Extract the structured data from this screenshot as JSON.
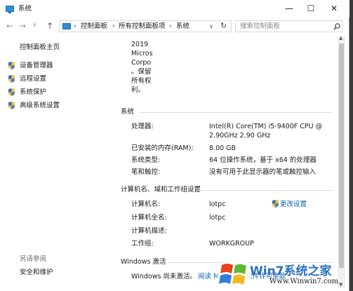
{
  "window": {
    "title": "系统",
    "minimize_glyph": "—",
    "maximize_glyph": "☐",
    "close_glyph": "✕"
  },
  "nav": {
    "back_glyph": "←",
    "forward_glyph": "→",
    "dropdown_glyph": "∨",
    "up_glyph": "↑",
    "breadcrumb": [
      "控制面板",
      "所有控制面板项",
      "系统"
    ],
    "separator": "›",
    "refresh_glyph": "↻",
    "search_placeholder": "搜索控制面板"
  },
  "sidebar": {
    "home": "控制面板主页",
    "items": [
      {
        "label": "设备管理器",
        "icon": "shield-icon"
      },
      {
        "label": "远程设置",
        "icon": "shield-icon"
      },
      {
        "label": "系统保护",
        "icon": "shield-icon"
      },
      {
        "label": "高级系统设置",
        "icon": "shield-icon"
      }
    ],
    "see_also": "另请参阅",
    "see_also_items": [
      "安全和维护"
    ]
  },
  "copyright_lines": [
    "2019",
    "Micros",
    "Corpo",
    "。保留",
    "所有权",
    "利。"
  ],
  "system": {
    "heading": "系统",
    "rows": [
      {
        "label": "处理器:",
        "value": "Intel(R) Core(TM) i5-9400F CPU @",
        "value2": "2.90GHz   2.90 GHz"
      },
      {
        "label": "已安装的内存(RAM):",
        "value": "8.00 GB"
      },
      {
        "label": "系统类型:",
        "value": "64 位操作系统，基于 x64 的处理器"
      },
      {
        "label": "笔和触控:",
        "value": "没有可用于此显示器的笔或触控输入"
      }
    ]
  },
  "computer": {
    "heading": "计算机名、域和工作组设置",
    "change_settings": "更改设置",
    "rows": [
      {
        "label": "计算机名:",
        "value": "lotpc"
      },
      {
        "label": "计算机全名:",
        "value": "lotpc"
      },
      {
        "label": "计算机描述:",
        "value": ""
      },
      {
        "label": "工作组:",
        "value": "WORKGROUP"
      }
    ]
  },
  "activation": {
    "heading": "Windows 激活",
    "status": "Windows 尚未激活。",
    "link": "阅读 Microsoft 软件许可条款"
  },
  "watermark": {
    "brand": "Win7系统之家",
    "url": "Www.Winwin7.com"
  },
  "colors": {
    "link": "#0b5fb5",
    "shield_blue": "#2f6fd0",
    "shield_yellow": "#f2c230"
  }
}
